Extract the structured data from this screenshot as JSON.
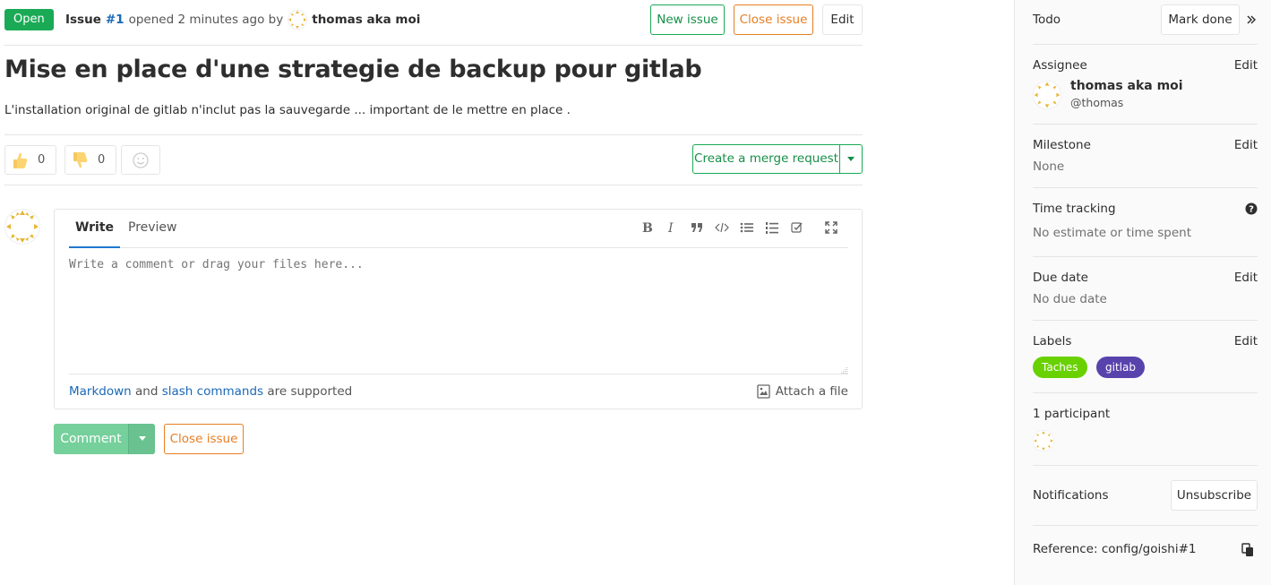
{
  "issue": {
    "status": "Open",
    "issue_word": "Issue",
    "number": "#1",
    "opened_text": "opened 2 minutes ago by",
    "author": "thomas aka moi",
    "title": "Mise en place d'une strategie de backup pour gitlab",
    "description": "L'installation original de gitlab n'inclut pas la sauvegarde ... important de le mettre en place ."
  },
  "header_actions": {
    "new_issue": "New issue",
    "close_issue": "Close issue",
    "edit": "Edit"
  },
  "awards": {
    "thumbs_up_count": "0",
    "thumbs_down_count": "0"
  },
  "merge_request": {
    "label": "Create a merge request"
  },
  "note_form": {
    "tab_write": "Write",
    "tab_preview": "Preview",
    "placeholder": "Write a comment or drag your files here...",
    "markdown_link": "Markdown",
    "and_text": "and",
    "slash_link": "slash commands",
    "supported_text": "are supported",
    "attach": "Attach a file",
    "comment_button": "Comment",
    "close_issue_button": "Close issue"
  },
  "sidebar": {
    "todo": {
      "title": "Todo",
      "button": "Mark done"
    },
    "assignee": {
      "title": "Assignee",
      "edit": "Edit",
      "name": "thomas aka moi",
      "username": "@thomas"
    },
    "milestone": {
      "title": "Milestone",
      "edit": "Edit",
      "value": "None"
    },
    "time_tracking": {
      "title": "Time tracking",
      "value": "No estimate or time spent"
    },
    "due_date": {
      "title": "Due date",
      "edit": "Edit",
      "value": "No due date"
    },
    "labels": {
      "title": "Labels",
      "edit": "Edit",
      "items": [
        {
          "name": "Taches",
          "color": "#69d100"
        },
        {
          "name": "gitlab",
          "color": "#5843ad"
        }
      ]
    },
    "participants": {
      "title": "1 participant"
    },
    "notifications": {
      "title": "Notifications",
      "button": "Unsubscribe"
    },
    "reference": {
      "text": "Reference: config/goishi#1"
    }
  },
  "colors": {
    "open_green": "#1aaa55",
    "close_orange": "#e67e22",
    "link_blue": "#1b69b6"
  }
}
